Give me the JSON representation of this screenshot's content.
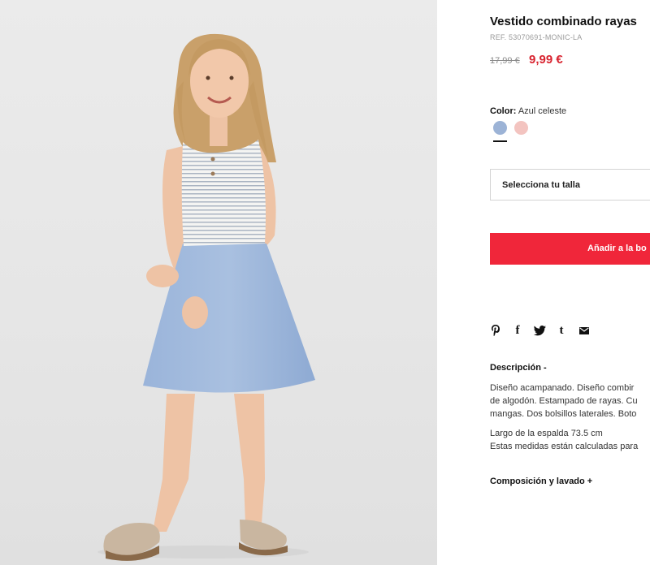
{
  "product": {
    "title": "Vestido combinado rayas",
    "ref": "REF. 53070691-MONIC-LA",
    "old_price": "17,99 €",
    "new_price": "9,99 €"
  },
  "color": {
    "label": "Color:",
    "value": "Azul celeste",
    "swatches": [
      {
        "name": "Azul celeste",
        "hex": "#9cb3d6",
        "selected": true
      },
      {
        "name": "Rosa",
        "hex": "#f3c4c0",
        "selected": false
      }
    ]
  },
  "size_select": {
    "placeholder": "Selecciona tu talla"
  },
  "add_button": {
    "label": "Añadir a la bo"
  },
  "share_icons": [
    "pinterest-icon",
    "facebook-icon",
    "twitter-icon",
    "tumblr-icon",
    "mail-icon"
  ],
  "description": {
    "title": "Descripción -",
    "lines": [
      "Diseño acampanado. Diseño combir",
      "de algodón. Estampado de rayas. Cu",
      "mangas. Dos bolsillos laterales. Boto"
    ],
    "measure_lines": [
      "Largo de la espalda 73.5 cm",
      "Estas medidas están calculadas para"
    ]
  },
  "composition": {
    "title": "Composición y lavado +"
  },
  "colors": {
    "accent_red": "#f0263a",
    "price_red": "#d8232f"
  }
}
